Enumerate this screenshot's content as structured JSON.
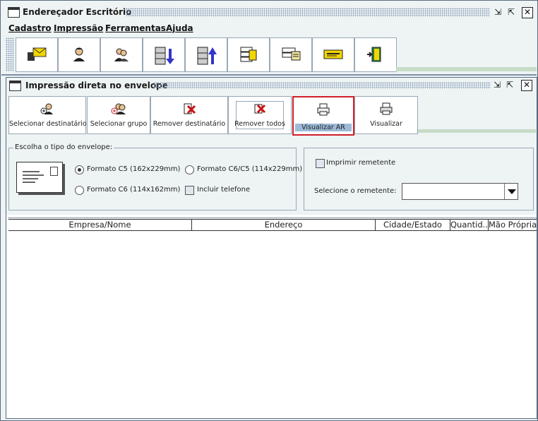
{
  "window": {
    "title": "Endereçador Escritório",
    "controls": [
      "minimize",
      "maximize",
      "close"
    ]
  },
  "menu": {
    "items": [
      "Cadastro",
      "Impressão",
      "Ferramentas",
      "Ajuda"
    ]
  },
  "main_toolbar": {
    "buttons": [
      {
        "icon": "envelope-icon"
      },
      {
        "icon": "person-icon"
      },
      {
        "icon": "group-icon"
      },
      {
        "icon": "import-icon"
      },
      {
        "icon": "export-icon"
      },
      {
        "icon": "database-icon"
      },
      {
        "icon": "card-file-icon"
      },
      {
        "icon": "label-icon"
      },
      {
        "icon": "exit-door-icon"
      }
    ]
  },
  "inner_window": {
    "title": "Impressão direta no envelope",
    "buttons": [
      {
        "label": "Selecionar destinatário",
        "icon": "add-person-icon"
      },
      {
        "label": "Selecionar grupo",
        "icon": "add-group-icon"
      },
      {
        "label": "Remover destinatário",
        "icon": "remove-person-icon"
      },
      {
        "label": "Remover todos",
        "icon": "remove-all-icon"
      },
      {
        "label": "Visualizar AR",
        "icon": "printer-icon"
      },
      {
        "label": "Visualizar",
        "icon": "printer-icon"
      }
    ],
    "envelope_group": {
      "title": "Escolha o tipo do envelope:",
      "options": {
        "c5": "Formato C5 (162x229mm)",
        "c6c5": "Formato C6/C5 (114x229mm)",
        "c6": "Formato C6 (114x162mm)"
      },
      "selected": "c5",
      "include_phone_label": "Incluir telefone",
      "include_phone_checked": false
    },
    "sender_group": {
      "print_sender_label": "Imprimir remetente",
      "print_sender_checked": false,
      "select_sender_label": "Selecione o remetente:",
      "select_sender_value": ""
    },
    "table": {
      "columns": [
        "Empresa/Nome",
        "Endereço",
        "Cidade/Estado",
        "Quantid...",
        "Mão Própria"
      ]
    }
  },
  "colors": {
    "accent_selected_border": "#d0202a",
    "selection_fill": "#9dbbd8",
    "panel_bg": "#eef3f4"
  }
}
